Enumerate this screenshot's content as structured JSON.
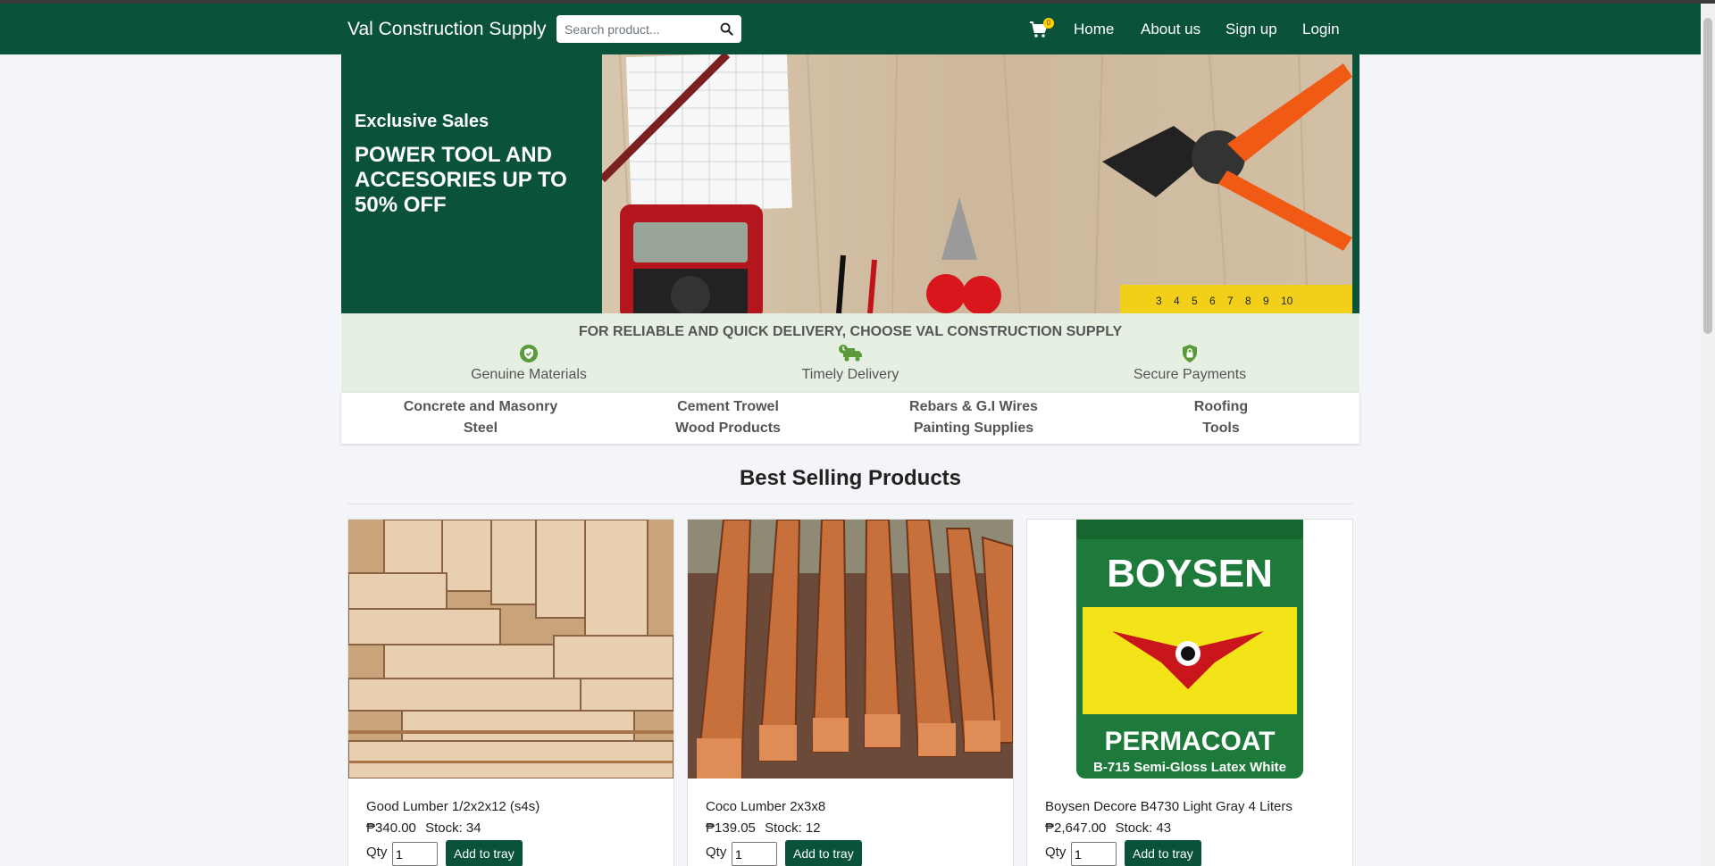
{
  "navbar": {
    "brand": "Val Construction Supply",
    "search_placeholder": "Search product...",
    "cart_count": "0",
    "links": [
      "Home",
      "About us",
      "Sign up",
      "Login"
    ]
  },
  "hero": {
    "subtitle": "Exclusive Sales",
    "title": "POWER TOOL AND ACCESORIES UP TO 50% OFF"
  },
  "features": {
    "title": "FOR RELIABLE AND QUICK DELIVERY, CHOOSE VAL CONSTRUCTION SUPPLY",
    "items": [
      {
        "label": "Genuine Materials",
        "icon": "shield-check-icon"
      },
      {
        "label": "Timely Delivery",
        "icon": "delivery-truck-icon"
      },
      {
        "label": "Secure Payments",
        "icon": "lock-shield-icon"
      }
    ]
  },
  "categories": [
    "Concrete and Masonry",
    "Cement Trowel",
    "Rebars & G.I Wires",
    "Roofing",
    "Steel",
    "Wood Products",
    "Painting Supplies",
    "Tools"
  ],
  "section": {
    "title": "Best Selling Products"
  },
  "products": [
    {
      "name": "Good Lumber 1/2x2x12 (s4s)",
      "price": "₱340.00",
      "stock": "Stock: 34",
      "qty_label": "Qty",
      "qty": "1",
      "button": "Add to tray"
    },
    {
      "name": "Coco Lumber 2x3x8",
      "price": "₱139.05",
      "stock": "Stock: 12",
      "qty_label": "Qty",
      "qty": "1",
      "button": "Add to tray"
    },
    {
      "name": "Boysen Decore B4730 Light Gray 4 Liters",
      "price": "₱2,647.00",
      "stock": "Stock: 43",
      "qty_label": "Qty",
      "qty": "1",
      "button": "Add to tray"
    }
  ],
  "product_image_text": {
    "brand": "BOYSEN",
    "line": "PERMACOAT",
    "sub": "B-715 Semi-Gloss Latex White"
  },
  "colors": {
    "primary": "#0a5239",
    "accent_badge": "#ffd100",
    "feature_bg": "#e6f0e2",
    "feature_icon": "#5a9a3a"
  }
}
